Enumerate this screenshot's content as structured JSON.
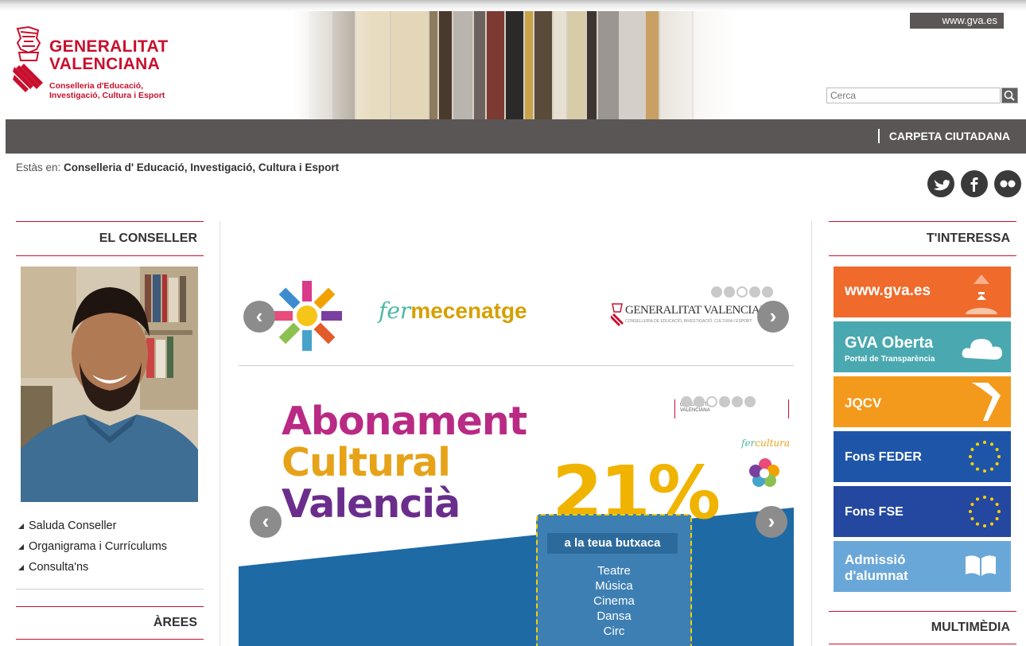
{
  "header": {
    "org_name_line1": "GENERALITAT",
    "org_name_line2": "VALENCIANA",
    "dept_line1": "Conselleria d'Educació,",
    "dept_line2": "Investigació, Cultura i Esport",
    "gva_link": "www.gva.es",
    "search_placeholder": "Cerca"
  },
  "nav": {
    "carpeta": "CARPETA CIUTADANA"
  },
  "breadcrumb": {
    "prefix": "Estàs en:",
    "current": "Conselleria d' Educació, Investigació, Cultura i Esport"
  },
  "social": [
    "twitter-icon",
    "facebook-icon",
    "flickr-icon"
  ],
  "left": {
    "title": "EL CONSELLER",
    "links": [
      "Saluda Conseller",
      "Organigrama i Currículums",
      "Consulta'ns"
    ],
    "areas_title": "ÀREES"
  },
  "carousel_top": {
    "brand1": "fer",
    "brand2": "mecenatge",
    "gv_logo": "GENERALITAT VALENCIANA",
    "gv_sub": "CONSELLERIA DE EDUCACIÓ, INVESTIGACIÓ, CULTURA I ESPORT",
    "dots": 5,
    "active_dot": 2
  },
  "banner": {
    "line1": "Abonament",
    "line2": "Cultural",
    "line3": "Valencià",
    "percent": "21%",
    "pocket_title": "a la teua butxaca",
    "items": [
      "Teatre",
      "Música",
      "Cinema",
      "Dansa",
      "Circ"
    ],
    "fercultura1": "fer",
    "fercultura2": "cultura",
    "gv_small": "GENERALITAT VALENCIANA",
    "dots": 6,
    "active_dot": 2
  },
  "right": {
    "title": "T'INTERESSA",
    "tiles": [
      {
        "label": "www.gva.es",
        "sub": "",
        "color": "#ef6a2b"
      },
      {
        "label": "GVA Oberta",
        "sub": "Portal de Transparència",
        "color": "#4aa8b0"
      },
      {
        "label": "JQCV",
        "sub": "",
        "color": "#f39a1c"
      },
      {
        "label": "Fons FEDER",
        "sub": "",
        "color": "#1e55a8"
      },
      {
        "label": "Fons FSE",
        "sub": "",
        "color": "#2447a0"
      },
      {
        "label": "Admissió",
        "sub": "d'alumnat",
        "color": "#6aa7d9"
      }
    ],
    "multimedia_title": "MULTIMÈDIA"
  }
}
